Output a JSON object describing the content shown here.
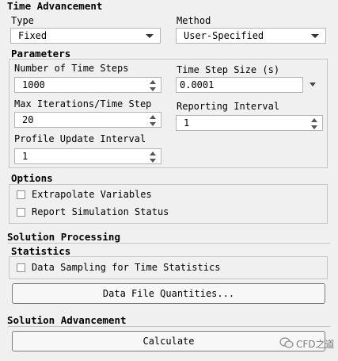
{
  "time_advancement": {
    "title": "Time Advancement",
    "type_label": "Type",
    "type_value": "Fixed",
    "method_label": "Method",
    "method_value": "User-Specified"
  },
  "parameters": {
    "title": "Parameters",
    "num_steps_label": "Number of Time Steps",
    "num_steps_value": "1000",
    "step_size_label": "Time Step Size (s)",
    "step_size_value": "0.0001",
    "max_iter_label": "Max Iterations/Time Step",
    "max_iter_value": "20",
    "reporting_label": "Reporting Interval",
    "reporting_value": "1",
    "profile_label": "Profile Update Interval",
    "profile_value": "1"
  },
  "options": {
    "title": "Options",
    "extrapolate_label": "Extrapolate Variables",
    "extrapolate_checked": false,
    "report_status_label": "Report Simulation Status",
    "report_status_checked": false
  },
  "solution_processing": {
    "title": "Solution Processing",
    "statistics_title": "Statistics",
    "sampling_label": "Data Sampling for Time Statistics",
    "sampling_checked": false,
    "data_file_button": "Data File Quantities..."
  },
  "solution_advancement": {
    "title": "Solution Advancement",
    "calculate_button": "Calculate"
  },
  "watermark": {
    "text": "CFD之道",
    "icon": "wechat-icon"
  }
}
